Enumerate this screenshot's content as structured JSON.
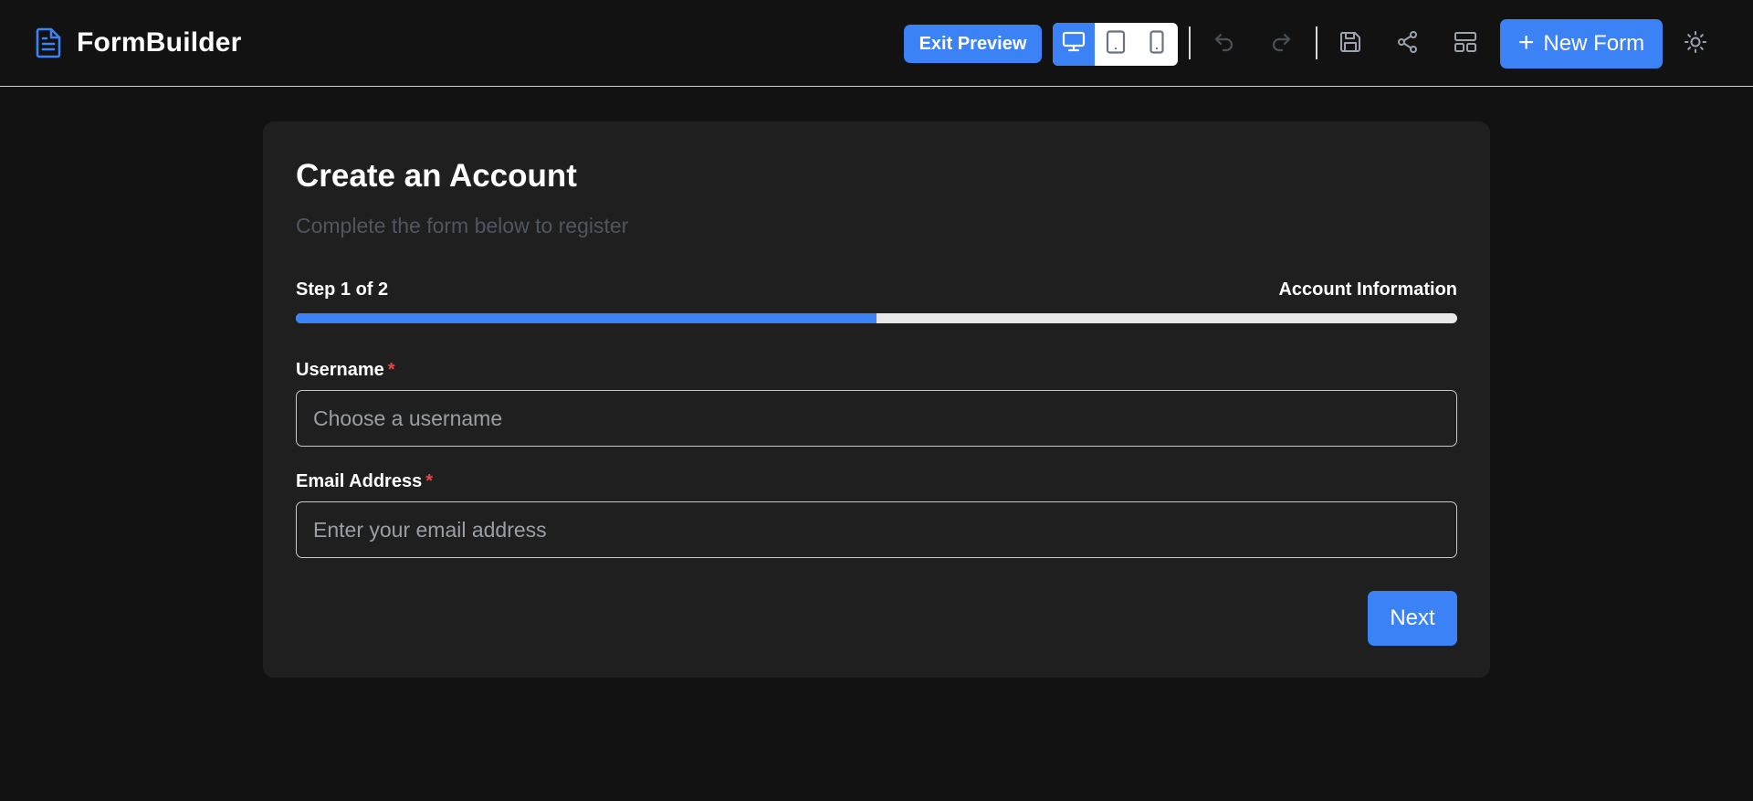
{
  "header": {
    "app_title": "FormBuilder",
    "exit_preview_label": "Exit Preview",
    "new_form_label": "New Form",
    "device_modes": [
      {
        "name": "desktop",
        "active": true
      },
      {
        "name": "tablet",
        "active": false
      },
      {
        "name": "mobile",
        "active": false
      }
    ],
    "icons": [
      "document-icon",
      "desktop-icon",
      "tablet-icon",
      "mobile-icon",
      "undo-icon",
      "redo-icon",
      "save-icon",
      "share-icon",
      "layout-icon",
      "plus-icon",
      "sun-icon"
    ]
  },
  "form": {
    "title": "Create an Account",
    "subtitle": "Complete the form below to register",
    "step_label": "Step 1 of 2",
    "step_name": "Account Information",
    "progress_fraction": 0.5,
    "fields": [
      {
        "label": "Username",
        "required_mark": "*",
        "placeholder": "Choose a username",
        "value": ""
      },
      {
        "label": "Email Address",
        "required_mark": "*",
        "placeholder": "Enter your email address",
        "value": ""
      }
    ],
    "next_label": "Next"
  },
  "colors": {
    "background": "#121212",
    "card": "#1f1f1f",
    "accent": "#3b82f6",
    "required": "#ef4444",
    "progress_track": "#e8e8e8"
  }
}
